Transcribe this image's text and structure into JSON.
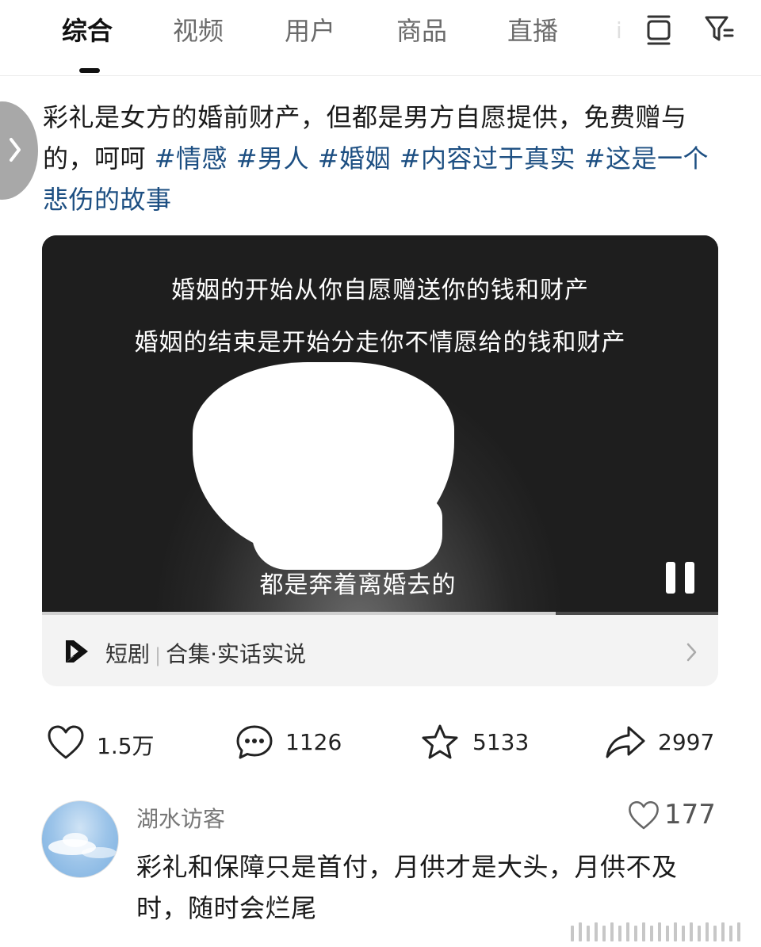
{
  "tabs": [
    {
      "label": "综合",
      "active": true
    },
    {
      "label": "视频"
    },
    {
      "label": "用户"
    },
    {
      "label": "商品"
    },
    {
      "label": "直播"
    }
  ],
  "post": {
    "text": "彩礼是女方的婚前财产，但都是男方自愿提供，免费赠与的，呵呵",
    "hashtags": [
      "#情感",
      "#男人",
      "#婚姻",
      "#内容过于真实",
      "#这是一个悲伤的故事"
    ]
  },
  "video": {
    "caption_line1": "婚姻的开始从你自愿赠送你的钱和财产",
    "caption_line2": "婚姻的结束是开始分走你不情愿给的钱和财产",
    "subtitle": "都是奔着离婚去的",
    "progress": 0.76
  },
  "collection": {
    "type": "短剧",
    "title": "合集·实话实说"
  },
  "actions": {
    "likes": "1.5万",
    "comments": "1126",
    "favorites": "5133",
    "shares": "2997"
  },
  "comment": {
    "username": "湖水访客",
    "likes": "177",
    "text": "彩礼和保障只是首付，月供才是大头，月供不及时，随时会烂尾"
  }
}
